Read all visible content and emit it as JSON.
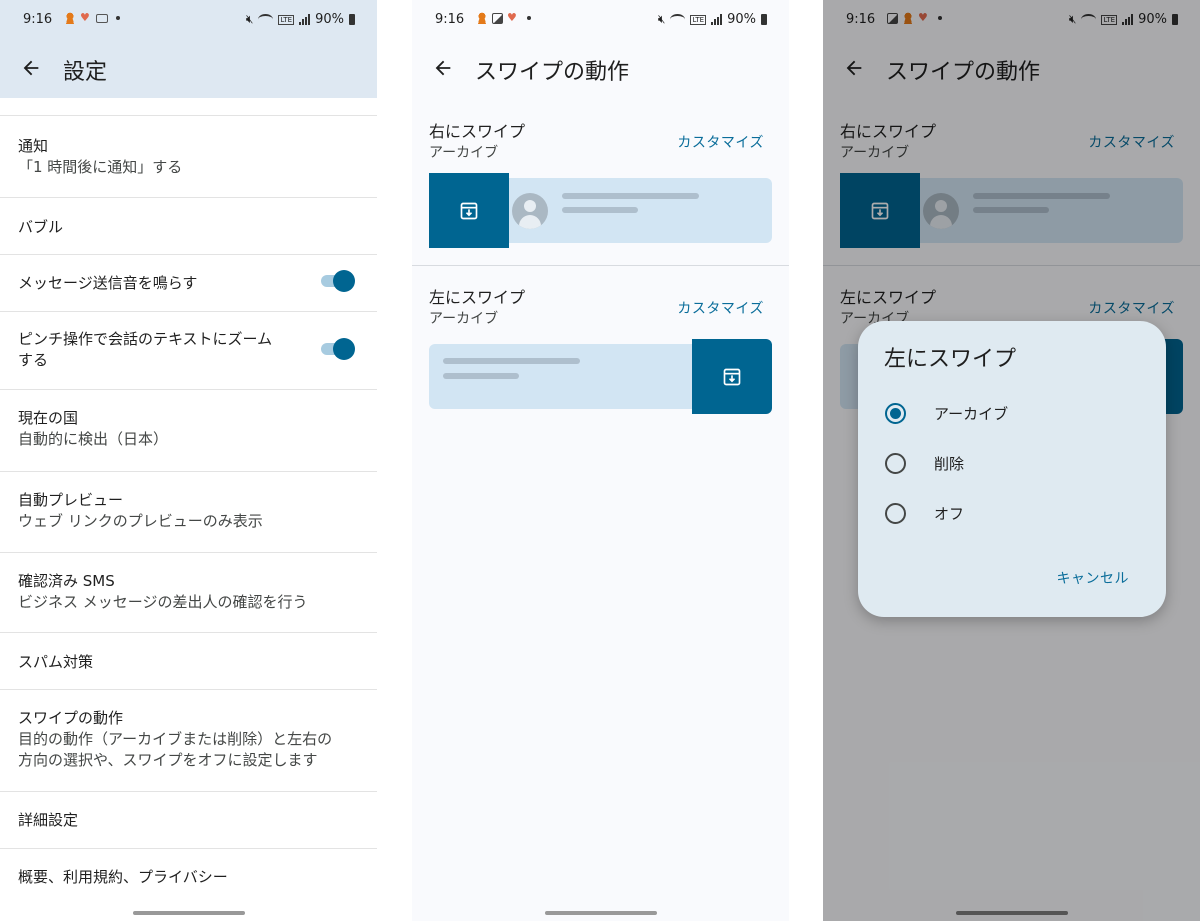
{
  "status": {
    "time": "9:16",
    "battery": "90%"
  },
  "settings_screen": {
    "title": "設定",
    "items": [
      {
        "title": "通知",
        "subtitle": "「1 時間後に通知」する"
      },
      {
        "title": "バブル"
      },
      {
        "title": "メッセージ送信音を鳴らす",
        "toggle": true
      },
      {
        "title": "ピンチ操作で会話のテキストにズームする",
        "title_l1": "ピンチ操作で会話のテキストにズーム",
        "title_l2": "する",
        "toggle": true
      },
      {
        "title": "現在の国",
        "subtitle": "自動的に検出（日本）"
      },
      {
        "title": "自動プレビュー",
        "subtitle": "ウェブ リンクのプレビューのみ表示"
      },
      {
        "title": "確認済み SMS",
        "subtitle": "ビジネス メッセージの差出人の確認を行う"
      },
      {
        "title": "スパム対策"
      },
      {
        "title": "スワイプの動作",
        "subtitle_l1": "目的の動作（アーカイブまたは削除）と左右の",
        "subtitle_l2": "方向の選択や、スワイプをオフに設定します"
      },
      {
        "title": "詳細設定"
      },
      {
        "title": "概要、利用規約、プライバシー"
      }
    ]
  },
  "swipe_screen": {
    "title": "スワイプの動作",
    "right": {
      "title": "右にスワイプ",
      "subtitle": "アーカイブ",
      "customize": "カスタマイズ"
    },
    "left": {
      "title": "左にスワイプ",
      "subtitle": "アーカイブ",
      "customize": "カスタマイズ"
    }
  },
  "dialog": {
    "title": "左にスワイプ",
    "options": [
      {
        "label": "アーカイブ",
        "selected": true
      },
      {
        "label": "削除",
        "selected": false
      },
      {
        "label": "オフ",
        "selected": false
      }
    ],
    "cancel": "キャンセル"
  },
  "colors": {
    "accent": "#006591",
    "appbar_bg": "#dee8f2",
    "preview_card": "#d2e5f3",
    "dialog_bg": "#dfeaf1"
  }
}
